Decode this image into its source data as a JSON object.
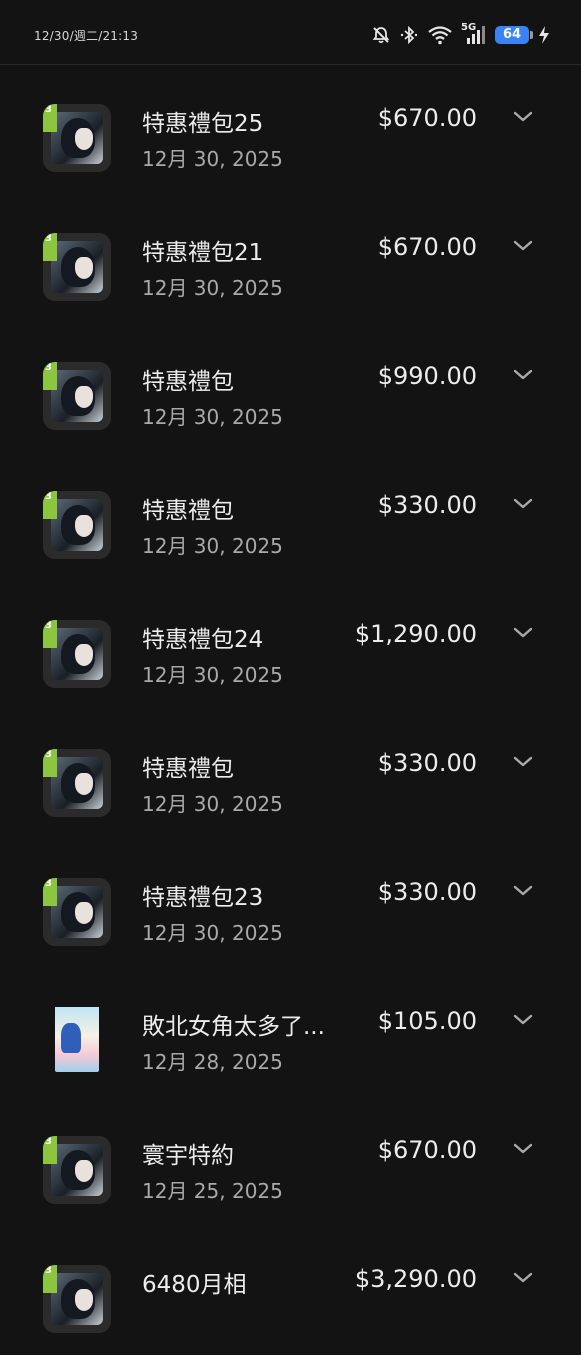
{
  "status_bar": {
    "time": "12/30/週二/21:13",
    "network": "5G",
    "battery": "64",
    "icons": [
      "mute-icon",
      "bluetooth-icon",
      "wifi-icon",
      "signal-icon",
      "battery-icon",
      "charging-icon"
    ]
  },
  "purchases": [
    {
      "title": "特惠禮包25",
      "date": "12月 30, 2025",
      "price": "$670.00",
      "icon": "game-app-icon"
    },
    {
      "title": "特惠禮包21",
      "date": "12月 30, 2025",
      "price": "$670.00",
      "icon": "game-app-icon"
    },
    {
      "title": "特惠禮包",
      "date": "12月 30, 2025",
      "price": "$990.00",
      "icon": "game-app-icon"
    },
    {
      "title": "特惠禮包",
      "date": "12月 30, 2025",
      "price": "$330.00",
      "icon": "game-app-icon"
    },
    {
      "title": "特惠禮包24",
      "date": "12月 30, 2025",
      "price": "$1,290.00",
      "icon": "game-app-icon"
    },
    {
      "title": "特惠禮包",
      "date": "12月 30, 2025",
      "price": "$330.00",
      "icon": "game-app-icon"
    },
    {
      "title": "特惠禮包23",
      "date": "12月 30, 2025",
      "price": "$330.00",
      "icon": "game-app-icon"
    },
    {
      "title": "敗北女角太多了...",
      "date": "12月 28, 2025",
      "price": "$105.00",
      "icon": "book-cover-icon"
    },
    {
      "title": "寰宇特約",
      "date": "12月 25, 2025",
      "price": "$670.00",
      "icon": "game-app-icon"
    },
    {
      "title": "6480月相",
      "date": "",
      "price": "$3,290.00",
      "icon": "game-app-icon"
    }
  ],
  "colors": {
    "background": "#131313",
    "text": "#ececec",
    "secondary": "#a9a9a9",
    "battery": "#3a82f7"
  }
}
